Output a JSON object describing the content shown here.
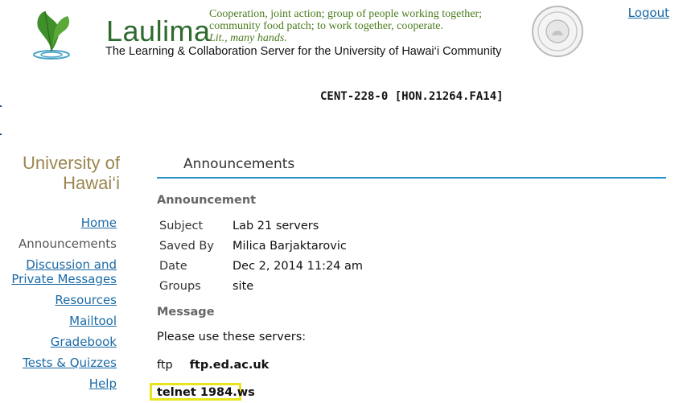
{
  "header": {
    "brand_word": "Laulima",
    "definition_line1": "Cooperation, joint action; group of people working together;",
    "definition_line2": "community food patch; to work together, cooperate.",
    "definition_line3": "Lit., many hands.",
    "tagline": "The Learning & Collaboration Server for the University of Hawai‘i Community",
    "logout_label": "Logout",
    "leaf_icon": "leaf-logo-icon",
    "seal_icon": "university-seal-icon"
  },
  "site": {
    "title": "CENT-228-0 [HON.21264.FA14]"
  },
  "sidebar": {
    "institution_line1": "University of",
    "institution_line2": "Hawai‘i",
    "items": [
      {
        "label": "Home",
        "active": false
      },
      {
        "label": "Announcements",
        "active": true
      },
      {
        "label": "Discussion and Private Messages",
        "active": false
      },
      {
        "label": "Resources",
        "active": false
      },
      {
        "label": "Mailtool",
        "active": false
      },
      {
        "label": "Gradebook",
        "active": false
      },
      {
        "label": "Tests & Quizzes",
        "active": false
      },
      {
        "label": "Help",
        "active": false
      }
    ]
  },
  "main": {
    "tool_title": "Announcements",
    "announcement_heading": "Announcement",
    "properties": [
      {
        "label": "Subject",
        "value": "Lab 21 servers"
      },
      {
        "label": "Saved By",
        "value": "Milica Barjaktarovic"
      },
      {
        "label": "Date",
        "value": "Dec 2, 2014 11:24 am"
      },
      {
        "label": "Groups",
        "value": "site"
      }
    ],
    "message_heading": "Message",
    "message_intro": "Please use these servers:",
    "servers": [
      {
        "protocol": "ftp",
        "host": "ftp.ed.ac.uk"
      },
      {
        "protocol": "telnet",
        "host": "1984.ws"
      }
    ]
  },
  "colors": {
    "link": "#1a6aa6",
    "brand_green": "#2f6b2e",
    "accent_rule": "#2b93c9",
    "highlight": "#e8e51e",
    "institution_gold": "#9b8650"
  }
}
